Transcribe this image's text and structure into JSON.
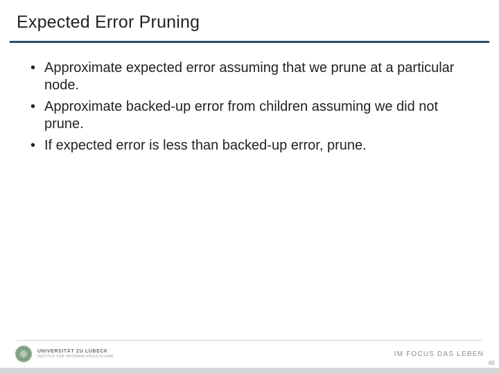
{
  "title": "Expected Error Pruning",
  "bullets": [
    "Approximate expected error assuming that we prune at a particular node.",
    "Approximate backed-up error from children assuming we did not prune.",
    "If expected error is less than backed-up error, prune."
  ],
  "footer": {
    "university_name": "UNIVERSITÄT ZU LÜBECK",
    "university_sub": "INSTITUT FÜR INFORMATIONSSYSTEME",
    "tagline": "IM FOCUS DAS LEBEN",
    "page_number": "46"
  }
}
